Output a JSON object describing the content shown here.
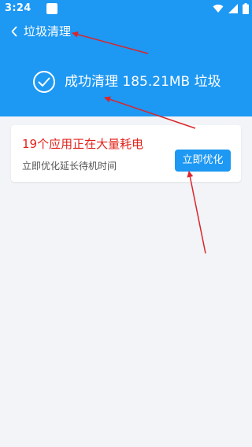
{
  "status_bar": {
    "time": "3:24"
  },
  "app_bar": {
    "back_icon": "chevron-left-icon",
    "title": "垃圾清理"
  },
  "result": {
    "icon": "check-circle-icon",
    "text": "成功清理 185.21MB 垃圾"
  },
  "card": {
    "title": "19个应用正在大量耗电",
    "subtitle": "立即优化延长待机时间",
    "button_label": "立即优化"
  },
  "colors": {
    "primary": "#1d98f3",
    "warning_text": "#e2231a",
    "background": "#f2f4f7",
    "annotation": "#d9262c"
  }
}
